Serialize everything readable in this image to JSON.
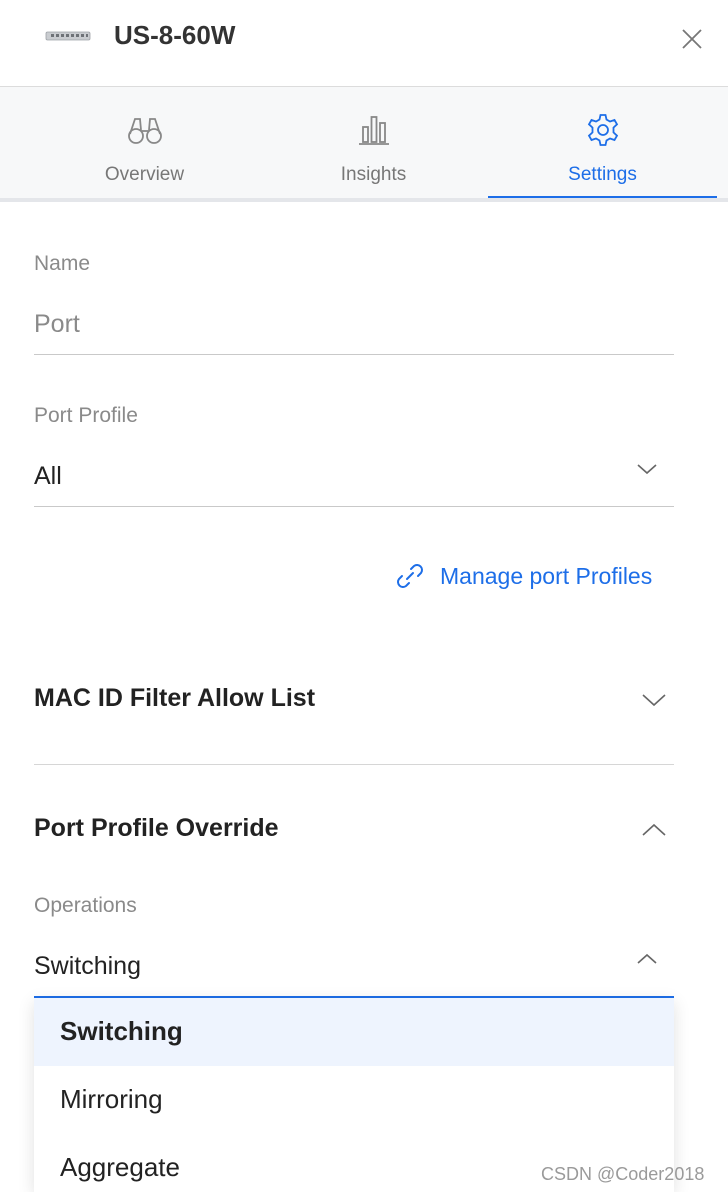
{
  "header": {
    "device_name": "US-8-60W"
  },
  "tabs": [
    {
      "label": "Overview",
      "icon": "binoculars-icon",
      "active": false
    },
    {
      "label": "Insights",
      "icon": "bar-chart-icon",
      "active": false
    },
    {
      "label": "Settings",
      "icon": "gear-icon",
      "active": true
    }
  ],
  "name_field": {
    "label": "Name",
    "placeholder": "Port",
    "value": ""
  },
  "port_profile": {
    "label": "Port Profile",
    "value": "All"
  },
  "manage_link": {
    "label": "Manage port Profiles",
    "icon": "link-icon"
  },
  "mac_filter": {
    "title": "MAC ID Filter Allow List",
    "expanded": false
  },
  "override": {
    "title": "Port Profile Override",
    "expanded": true,
    "operations_label": "Operations",
    "operations_value": "Switching",
    "options": [
      "Switching",
      "Mirroring",
      "Aggregate"
    ],
    "selected_option": "Switching"
  },
  "colors": {
    "accent": "#1d6ee8",
    "selected_bg": "#eef4fe"
  },
  "watermark": "CSDN @Coder2018"
}
